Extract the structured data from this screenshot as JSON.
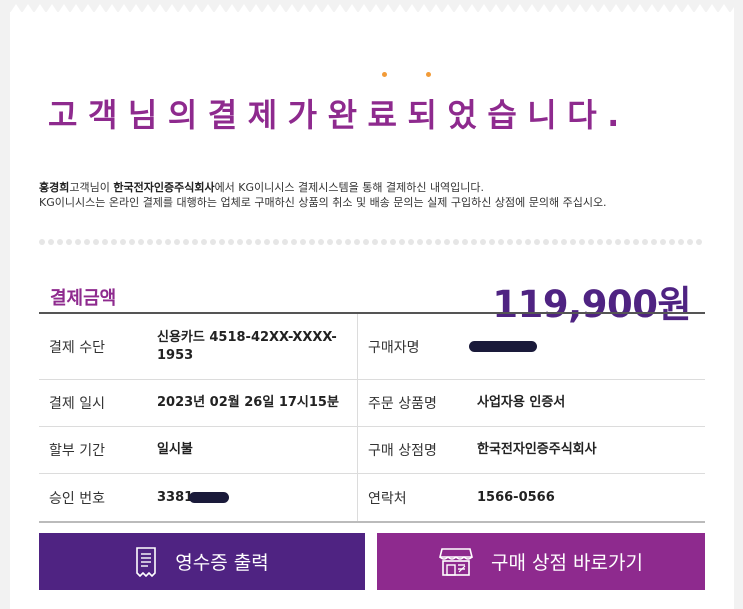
{
  "headline": "고객님의결제가완료되었습니다.",
  "notice": {
    "customer_name": "홍경희",
    "customer_suffix": "고객님이 ",
    "merchant": "한국전자인증주식회사",
    "line1_rest": "에서 KG이니시스 결제시스템을 통해 결제하신 내역입니다.",
    "line2": "KG이니시스는 온라인 결제를 대행하는 업체로 구매하신 상품의 취소 및 배송 문의는 실제 구입하신 상점에 문의해 주십시오."
  },
  "amount": {
    "label": "결제금액",
    "value": "119,900원"
  },
  "details": {
    "payment_method": {
      "label": "결제 수단",
      "value": "신용카드 4518-42XX-XXXX-1953"
    },
    "buyer_name": {
      "label": "구매자명",
      "value": ""
    },
    "payment_date": {
      "label": "결제 일시",
      "value": "2023년 02월 26일 17시15분"
    },
    "product_name": {
      "label": "주문 상품명",
      "value": "사업자용 인증서"
    },
    "installment": {
      "label": "할부 기간",
      "value": "일시불"
    },
    "store_name": {
      "label": "구매 상점명",
      "value": "한국전자인증주식회사"
    },
    "approval_no": {
      "label": "승인 번호",
      "value": "3381"
    },
    "contact": {
      "label": "연락처",
      "value": "1566-0566"
    }
  },
  "buttons": {
    "print_label": "영수증 출력",
    "store_label": "구매 상점 바로가기"
  },
  "colors": {
    "headline": "#8e2a8e",
    "accent_dark": "#4f2382",
    "accent": "#8e2a8e",
    "emphasis_dots": "#f29b38"
  },
  "icons": {
    "print": "receipt-icon",
    "store": "storefront-icon"
  }
}
